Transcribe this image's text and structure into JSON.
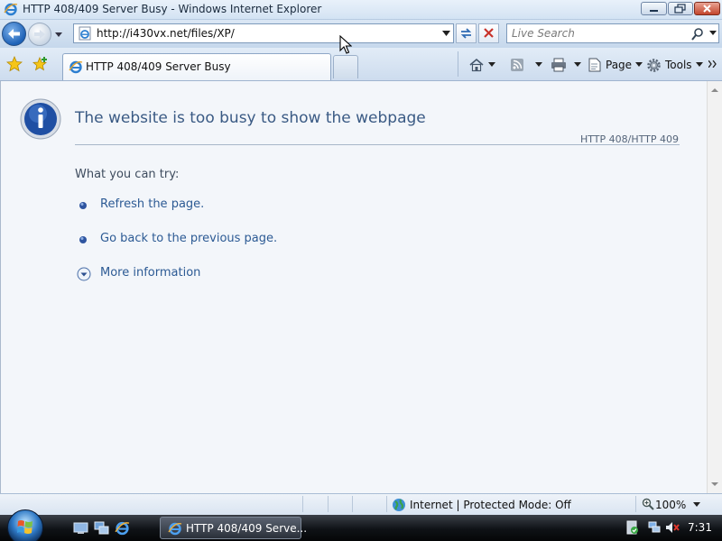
{
  "window": {
    "title": "HTTP 408/409 Server Busy - Windows Internet Explorer"
  },
  "address_bar": {
    "url": "http://i430vx.net/files/XP/"
  },
  "search": {
    "placeholder": "Live Search"
  },
  "tabs": [
    {
      "label": "HTTP 408/409 Server Busy",
      "active": true
    }
  ],
  "command_bar": {
    "page_label": "Page",
    "tools_label": "Tools"
  },
  "content": {
    "heading": "The website is too busy to show the webpage",
    "error_code": "HTTP 408/HTTP 409",
    "try_label": "What you can try:",
    "options": [
      {
        "label": "Refresh the page."
      },
      {
        "label": "Go back to the previous page."
      },
      {
        "label": "More information"
      }
    ]
  },
  "status_bar": {
    "zone": "Internet | Protected Mode: Off",
    "zoom": "100%"
  },
  "taskbar": {
    "active_window_label": "HTTP 408/409 Serve...",
    "clock": "7:31"
  },
  "colors": {
    "heading": "#3a5a84",
    "link": "#2c5a94",
    "content_bg": "#f3f6fa"
  }
}
